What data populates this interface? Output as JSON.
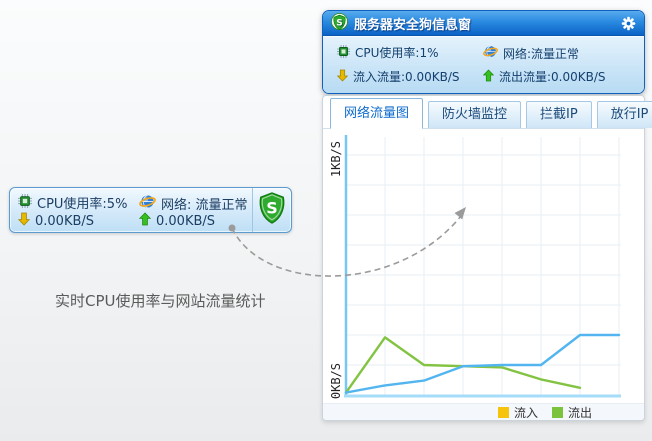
{
  "caption": "实时CPU使用率与网站流量统计",
  "widget": {
    "logo": "S",
    "cpu": "CPU使用率:5%",
    "network": "网络: 流量正常",
    "inflow": "0.00KB/S",
    "outflow": "0.00KB/S"
  },
  "win": {
    "title": "服务器安全狗信息窗",
    "logo": "S",
    "status": {
      "cpu": "CPU使用率:1%",
      "network": "网络:流量正常",
      "inflow": "流入流量:0.00KB/S",
      "outflow": "流出流量:0.00KB/S"
    },
    "tabs": [
      {
        "label": "网络流量图",
        "active": true
      },
      {
        "label": "防火墙监控",
        "active": false
      },
      {
        "label": "拦截IP",
        "active": false
      },
      {
        "label": "放行IP",
        "active": false
      }
    ]
  },
  "chart_data": {
    "type": "line",
    "title": "",
    "ylabel_top": "1KB/S",
    "ylabel_bottom": "0KB/S",
    "y_unit": "KB/S",
    "ylim": [
      0,
      1
    ],
    "x": [
      0,
      1,
      2,
      3,
      4,
      5,
      6,
      7
    ],
    "grid": true,
    "legend_position": "bottom-right",
    "axis_color": "#76c8f3",
    "grid_color": "#e9eff5",
    "series": [
      {
        "name": "流入",
        "line_color": "#53b5f0",
        "legend_color": "#f7c40c",
        "values": [
          0.01,
          0.04,
          0.06,
          0.12,
          0.125,
          0.125,
          0.25,
          0.25
        ]
      },
      {
        "name": "流出",
        "line_color": "#82c341",
        "legend_color": "#7cc33c",
        "values": [
          0.01,
          0.24,
          0.125,
          0.12,
          0.115,
          0.065,
          0.03
        ]
      }
    ]
  },
  "colors": {
    "titlebar_top": "#58abee",
    "titlebar_bottom": "#0a62c6",
    "status_text": "#14406e",
    "tab_active_text": "#0d6bce",
    "widget_border": "#5b9bd0",
    "shield_green": "#2eab2e"
  }
}
